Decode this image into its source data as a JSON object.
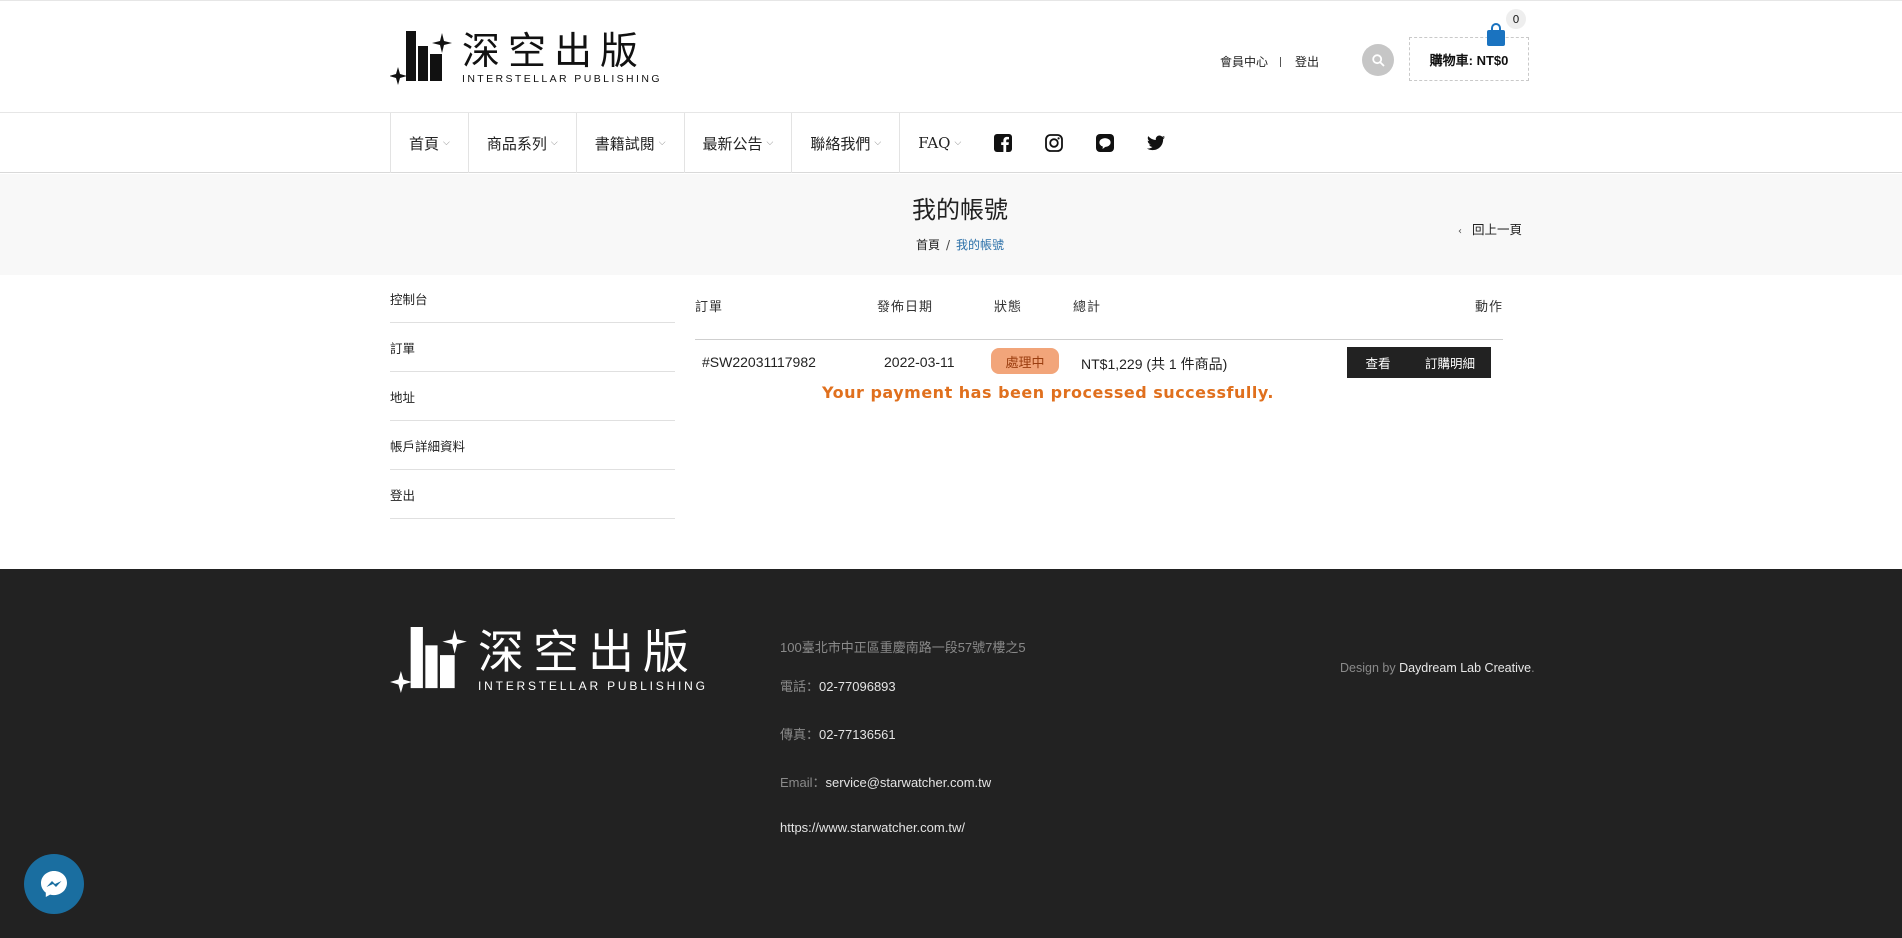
{
  "header": {
    "logo_cn": "深空出版",
    "logo_en": "INTERSTELLAR PUBLISHING",
    "member_center": "會員中心",
    "logout": "登出",
    "cart_label": "購物車: NT$0",
    "cart_count": "0"
  },
  "nav": {
    "items": [
      {
        "label": "首頁"
      },
      {
        "label": "商品系列"
      },
      {
        "label": "書籍試閱"
      },
      {
        "label": "最新公告"
      },
      {
        "label": "聯絡我們"
      }
    ],
    "faq": "FAQ",
    "social_icons": [
      "facebook-icon",
      "instagram-icon",
      "line-icon",
      "twitter-icon"
    ]
  },
  "page": {
    "title": "我的帳號",
    "breadcrumb_home": "首頁",
    "breadcrumb_current": "我的帳號",
    "back": "回上一頁"
  },
  "sidebar": {
    "items": [
      {
        "label": "控制台"
      },
      {
        "label": "訂單"
      },
      {
        "label": "地址"
      },
      {
        "label": "帳戶詳細資料"
      },
      {
        "label": "登出"
      }
    ]
  },
  "orders": {
    "headers": {
      "order": "訂單",
      "date": "發佈日期",
      "status": "狀態",
      "total": "總計",
      "actions": "動作"
    },
    "row": {
      "id": "#SW22031117982",
      "date": "2022-03-11",
      "status": "處理中",
      "total": "NT$1,229 (共 1 件商品)",
      "view": "查看",
      "detail": "訂購明細"
    },
    "message": "Your payment has been processed successfully."
  },
  "footer": {
    "logo_cn": "深空出版",
    "logo_en": "INTERSTELLAR PUBLISHING",
    "address": "100臺北市中正區重慶南路一段57號7樓之5",
    "phone_label": "電話：",
    "phone": "02-77096893",
    "fax_label": "傳真：",
    "fax": "02-77136561",
    "email_label": "Email：",
    "email": "service@starwatcher.com.tw",
    "website": "https://www.starwatcher.com.tw/",
    "design_by": "Design by",
    "designer": "Daydream Lab Creative",
    "period": "."
  },
  "colors": {
    "footer_bg": "#222222",
    "accent_blue": "#2a6fa8",
    "status_bg": "#f2a57a",
    "success_text": "#e0701e",
    "messenger": "#1a6ea0"
  }
}
